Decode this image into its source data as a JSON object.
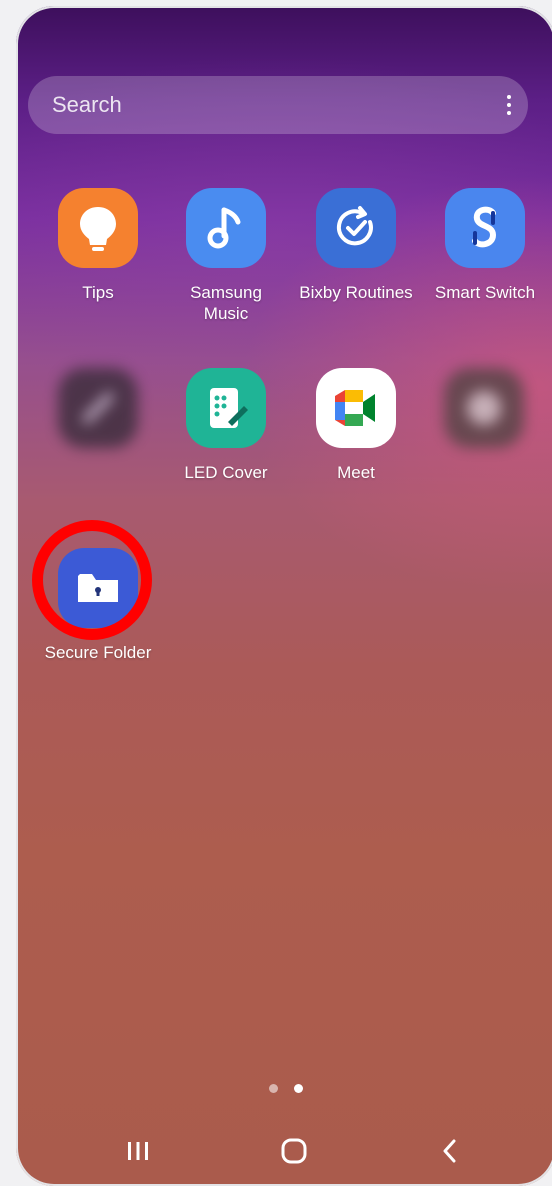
{
  "search": {
    "placeholder": "Search",
    "menu_icon": "more-vert-icon"
  },
  "apps_row1": [
    {
      "label": "Tips",
      "icon": "lightbulb-icon",
      "color": "#f5812f"
    },
    {
      "label": "Samsung\nMusic",
      "icon": "music-note-icon",
      "color": "#4a8cf0"
    },
    {
      "label": "Bixby Routines",
      "icon": "routine-check-icon",
      "color": "#3a6fd6"
    },
    {
      "label": "Smart Switch",
      "icon": "smart-switch-icon",
      "color": "#4a86ee"
    }
  ],
  "apps_row2": [
    {
      "label": "",
      "icon": "blurred-app-icon",
      "blurred": true
    },
    {
      "label": "LED Cover",
      "icon": "led-cover-icon",
      "color": "#1fb496"
    },
    {
      "label": "Meet",
      "icon": "google-meet-icon",
      "color": "#ffffff"
    },
    {
      "label": "",
      "icon": "blurred-app-icon",
      "blurred": true
    }
  ],
  "secure_folder": {
    "label": "Secure Folder",
    "icon": "secure-folder-icon",
    "color": "#3c5ad6"
  },
  "highlight_color": "#ff0000",
  "page_indicator": {
    "pages": 2,
    "active_page": 2
  },
  "navbar": {
    "recents": "recents-icon",
    "home": "home-icon",
    "back": "back-icon"
  }
}
